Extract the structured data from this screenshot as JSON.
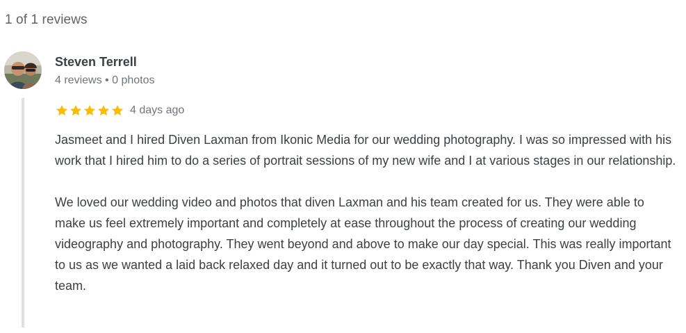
{
  "review_count_label": "1 of 1 reviews",
  "review": {
    "author_name": "Steven Terrell",
    "author_reviews": "4 reviews",
    "separator": "•",
    "author_photos": "0 photos",
    "rating": 5,
    "rating_max": 5,
    "star_color": "#fbbc04",
    "date": "4 days ago",
    "paragraphs": [
      "Jasmeet and I hired Diven Laxman from Ikonic Media for our wedding photography. I was so impressed with his work that I hired him to do a series of portrait sessions of my new wife and I at various stages in our relationship.",
      "We loved our wedding video and photos that diven Laxman and his team created for us. They were able to make us feel extremely important and completely at ease throughout the process of creating our wedding videography and photography. They went beyond and above to make our day special. This was really important to us as we wanted a laid back relaxed day and it turned out to be exactly that way. Thank you Diven and your team."
    ]
  }
}
